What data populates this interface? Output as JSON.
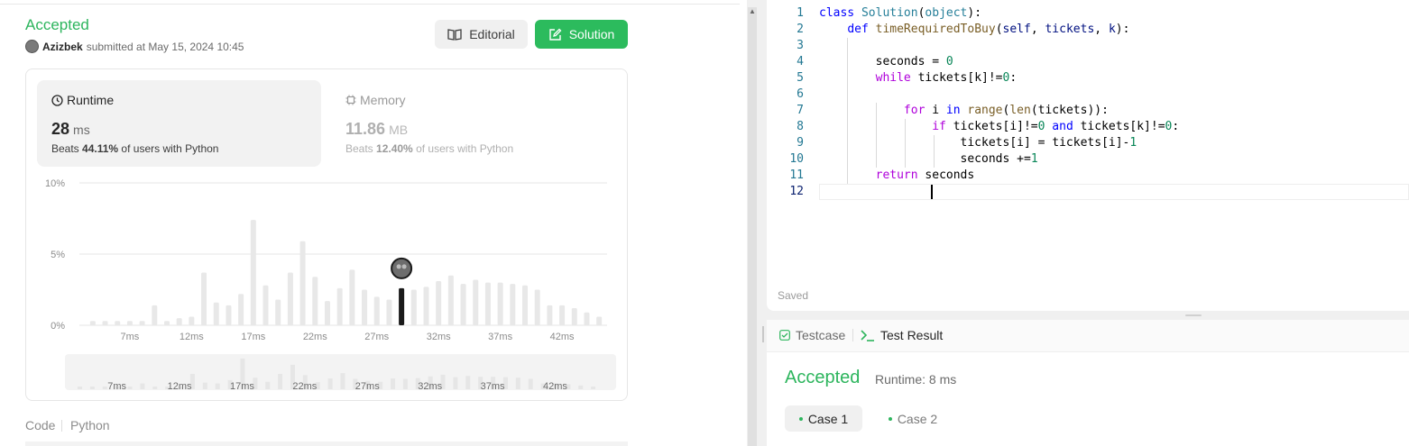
{
  "submission": {
    "status": "Accepted",
    "username": "Azizbek",
    "submitted_text": "submitted at May 15, 2024 10:45",
    "editorial_label": "Editorial",
    "solution_label": "Solution"
  },
  "runtime": {
    "title": "Runtime",
    "value": "28",
    "unit": "ms",
    "beats_prefix": "Beats",
    "beats_pct": "44.11%",
    "beats_suffix": "of users with Python"
  },
  "memory": {
    "title": "Memory",
    "value": "11.86",
    "unit": "MB",
    "beats_prefix": "Beats",
    "beats_pct": "12.40%",
    "beats_suffix": "of users with Python"
  },
  "chart_data": {
    "type": "bar",
    "y_ticks": [
      "10%",
      "5%",
      "0%"
    ],
    "ylim": [
      0,
      10
    ],
    "x_labels": [
      "7ms",
      "12ms",
      "17ms",
      "22ms",
      "27ms",
      "32ms",
      "37ms",
      "42ms"
    ],
    "values": [
      0.3,
      0.3,
      0.3,
      0.3,
      0.3,
      1.4,
      0.3,
      0.5,
      0.6,
      3.7,
      1.6,
      1.4,
      2.2,
      7.4,
      2.8,
      1.8,
      3.7,
      5.9,
      3.4,
      1.7,
      2.6,
      3.9,
      2.5,
      2.0,
      1.8,
      2.6,
      2.5,
      2.7,
      3.1,
      3.5,
      2.9,
      3.2,
      3.0,
      3.0,
      2.9,
      2.8,
      2.5,
      1.4,
      1.4,
      1.2,
      0.9,
      0.6
    ],
    "highlight_index": 25,
    "colors": {
      "bar": "#e8e8e8",
      "highlight": "#1a1a1a",
      "grid": "#e6e6e6"
    }
  },
  "code_section": {
    "label": "Code",
    "language": "Python"
  },
  "editor": {
    "lines": [
      [
        {
          "t": "class ",
          "c": "kw"
        },
        {
          "t": "Solution",
          "c": "cls"
        },
        {
          "t": "(",
          "c": ""
        },
        {
          "t": "object",
          "c": "cls"
        },
        {
          "t": "):",
          "c": ""
        }
      ],
      [
        {
          "t": "    ",
          "c": ""
        },
        {
          "t": "def ",
          "c": "kw"
        },
        {
          "t": "timeRequiredToBuy",
          "c": "fn"
        },
        {
          "t": "(",
          "c": ""
        },
        {
          "t": "self",
          "c": "param"
        },
        {
          "t": ", ",
          "c": ""
        },
        {
          "t": "tickets",
          "c": "param"
        },
        {
          "t": ", ",
          "c": ""
        },
        {
          "t": "k",
          "c": "param"
        },
        {
          "t": "):",
          "c": ""
        }
      ],
      [],
      [
        {
          "t": "        seconds = ",
          "c": ""
        },
        {
          "t": "0",
          "c": "num"
        }
      ],
      [
        {
          "t": "        ",
          "c": ""
        },
        {
          "t": "while",
          "c": "kw2"
        },
        {
          "t": " tickets[k]!=",
          "c": ""
        },
        {
          "t": "0",
          "c": "num"
        },
        {
          "t": ":",
          "c": ""
        }
      ],
      [],
      [
        {
          "t": "            ",
          "c": ""
        },
        {
          "t": "for",
          "c": "kw2"
        },
        {
          "t": " i ",
          "c": ""
        },
        {
          "t": "in",
          "c": "kw"
        },
        {
          "t": " ",
          "c": ""
        },
        {
          "t": "range",
          "c": "fn"
        },
        {
          "t": "(",
          "c": ""
        },
        {
          "t": "len",
          "c": "fn"
        },
        {
          "t": "(tickets)):",
          "c": ""
        }
      ],
      [
        {
          "t": "                ",
          "c": ""
        },
        {
          "t": "if",
          "c": "kw2"
        },
        {
          "t": " tickets[i]!=",
          "c": ""
        },
        {
          "t": "0",
          "c": "num"
        },
        {
          "t": " ",
          "c": ""
        },
        {
          "t": "and",
          "c": "kw"
        },
        {
          "t": " tickets[k]!=",
          "c": ""
        },
        {
          "t": "0",
          "c": "num"
        },
        {
          "t": ":",
          "c": ""
        }
      ],
      [
        {
          "t": "                    tickets[i] = tickets[i]-",
          "c": ""
        },
        {
          "t": "1",
          "c": "num"
        }
      ],
      [
        {
          "t": "                    seconds +=",
          "c": ""
        },
        {
          "t": "1",
          "c": "num"
        }
      ],
      [
        {
          "t": "        ",
          "c": ""
        },
        {
          "t": "return",
          "c": "kw2"
        },
        {
          "t": " seconds",
          "c": ""
        }
      ],
      []
    ],
    "current_line": 12,
    "saved_label": "Saved"
  },
  "test_panel": {
    "tab_testcase": "Testcase",
    "tab_result": "Test Result",
    "result_status": "Accepted",
    "result_runtime": "Runtime: 8 ms",
    "cases": [
      "Case 1",
      "Case 2"
    ]
  }
}
